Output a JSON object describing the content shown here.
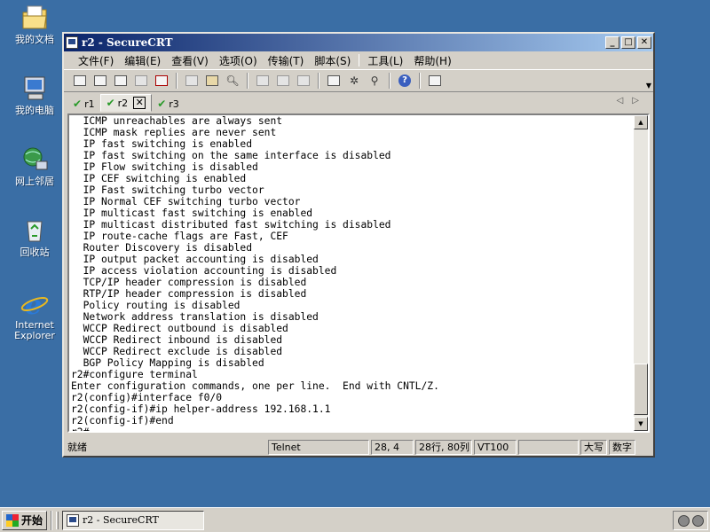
{
  "desktop": {
    "icons": [
      {
        "label": "我的文档",
        "icon": "folder-documents-icon"
      },
      {
        "label": "我的电脑",
        "icon": "computer-icon"
      },
      {
        "label": "网上邻居",
        "icon": "network-icon"
      },
      {
        "label": "回收站",
        "icon": "recycle-bin-icon"
      },
      {
        "label": "Internet Explorer",
        "icon": "internet-explorer-icon"
      }
    ]
  },
  "window": {
    "title": "r2 - SecureCRT",
    "controls": {
      "minimize": "_",
      "maximize": "□",
      "close": "✕"
    }
  },
  "menu": {
    "items": [
      "文件(F)",
      "编辑(E)",
      "查看(V)",
      "选项(O)",
      "传输(T)",
      "脚本(S)",
      "工具(L)",
      "帮助(H)"
    ]
  },
  "toolbar": {
    "icons": [
      "connect-icon",
      "quick-connect-icon",
      "connect-tab-icon",
      "reconnect-icon",
      "disconnect-icon",
      "copy-icon",
      "paste-icon",
      "find-icon",
      "print-icon",
      "print-selection-icon",
      "printer-setup-icon",
      "session-options-icon",
      "global-options-icon",
      "key-icon",
      "help-icon",
      "keymap-icon"
    ]
  },
  "tabs": [
    {
      "label": "r1",
      "active": false
    },
    {
      "label": "r2",
      "active": true
    },
    {
      "label": "r3",
      "active": false
    }
  ],
  "tab_nav": {
    "left": "◁",
    "right": "▷"
  },
  "terminal": {
    "lines": [
      "  ICMP unreachables are always sent",
      "  ICMP mask replies are never sent",
      "  IP fast switching is enabled",
      "  IP fast switching on the same interface is disabled",
      "  IP Flow switching is disabled",
      "  IP CEF switching is enabled",
      "  IP Fast switching turbo vector",
      "  IP Normal CEF switching turbo vector",
      "  IP multicast fast switching is enabled",
      "  IP multicast distributed fast switching is disabled",
      "  IP route-cache flags are Fast, CEF",
      "  Router Discovery is disabled",
      "  IP output packet accounting is disabled",
      "  IP access violation accounting is disabled",
      "  TCP/IP header compression is disabled",
      "  RTP/IP header compression is disabled",
      "  Policy routing is disabled",
      "  Network address translation is disabled",
      "  WCCP Redirect outbound is disabled",
      "  WCCP Redirect inbound is disabled",
      "  WCCP Redirect exclude is disabled",
      "  BGP Policy Mapping is disabled",
      "r2#configure terminal",
      "Enter configuration commands, one per line.  End with CNTL/Z.",
      "r2(config)#interface f0/0",
      "r2(config-if)#ip helper-address 192.168.1.1",
      "r2(config-if)#end",
      "r2#"
    ]
  },
  "status": {
    "ready": "就绪",
    "protocol": "Telnet",
    "cursor_pos": "28,  4",
    "size": "28行, 80列",
    "emulation": "VT100",
    "blank": "",
    "caps": "大写",
    "num": "数字"
  },
  "taskbar": {
    "start_label": "开始",
    "task_label": "r2 - SecureCRT"
  },
  "colors": {
    "desktop": "#3a6ea5",
    "titlebar_start": "#0a246a",
    "titlebar_end": "#a6caf0",
    "chrome": "#d4d0c8"
  }
}
